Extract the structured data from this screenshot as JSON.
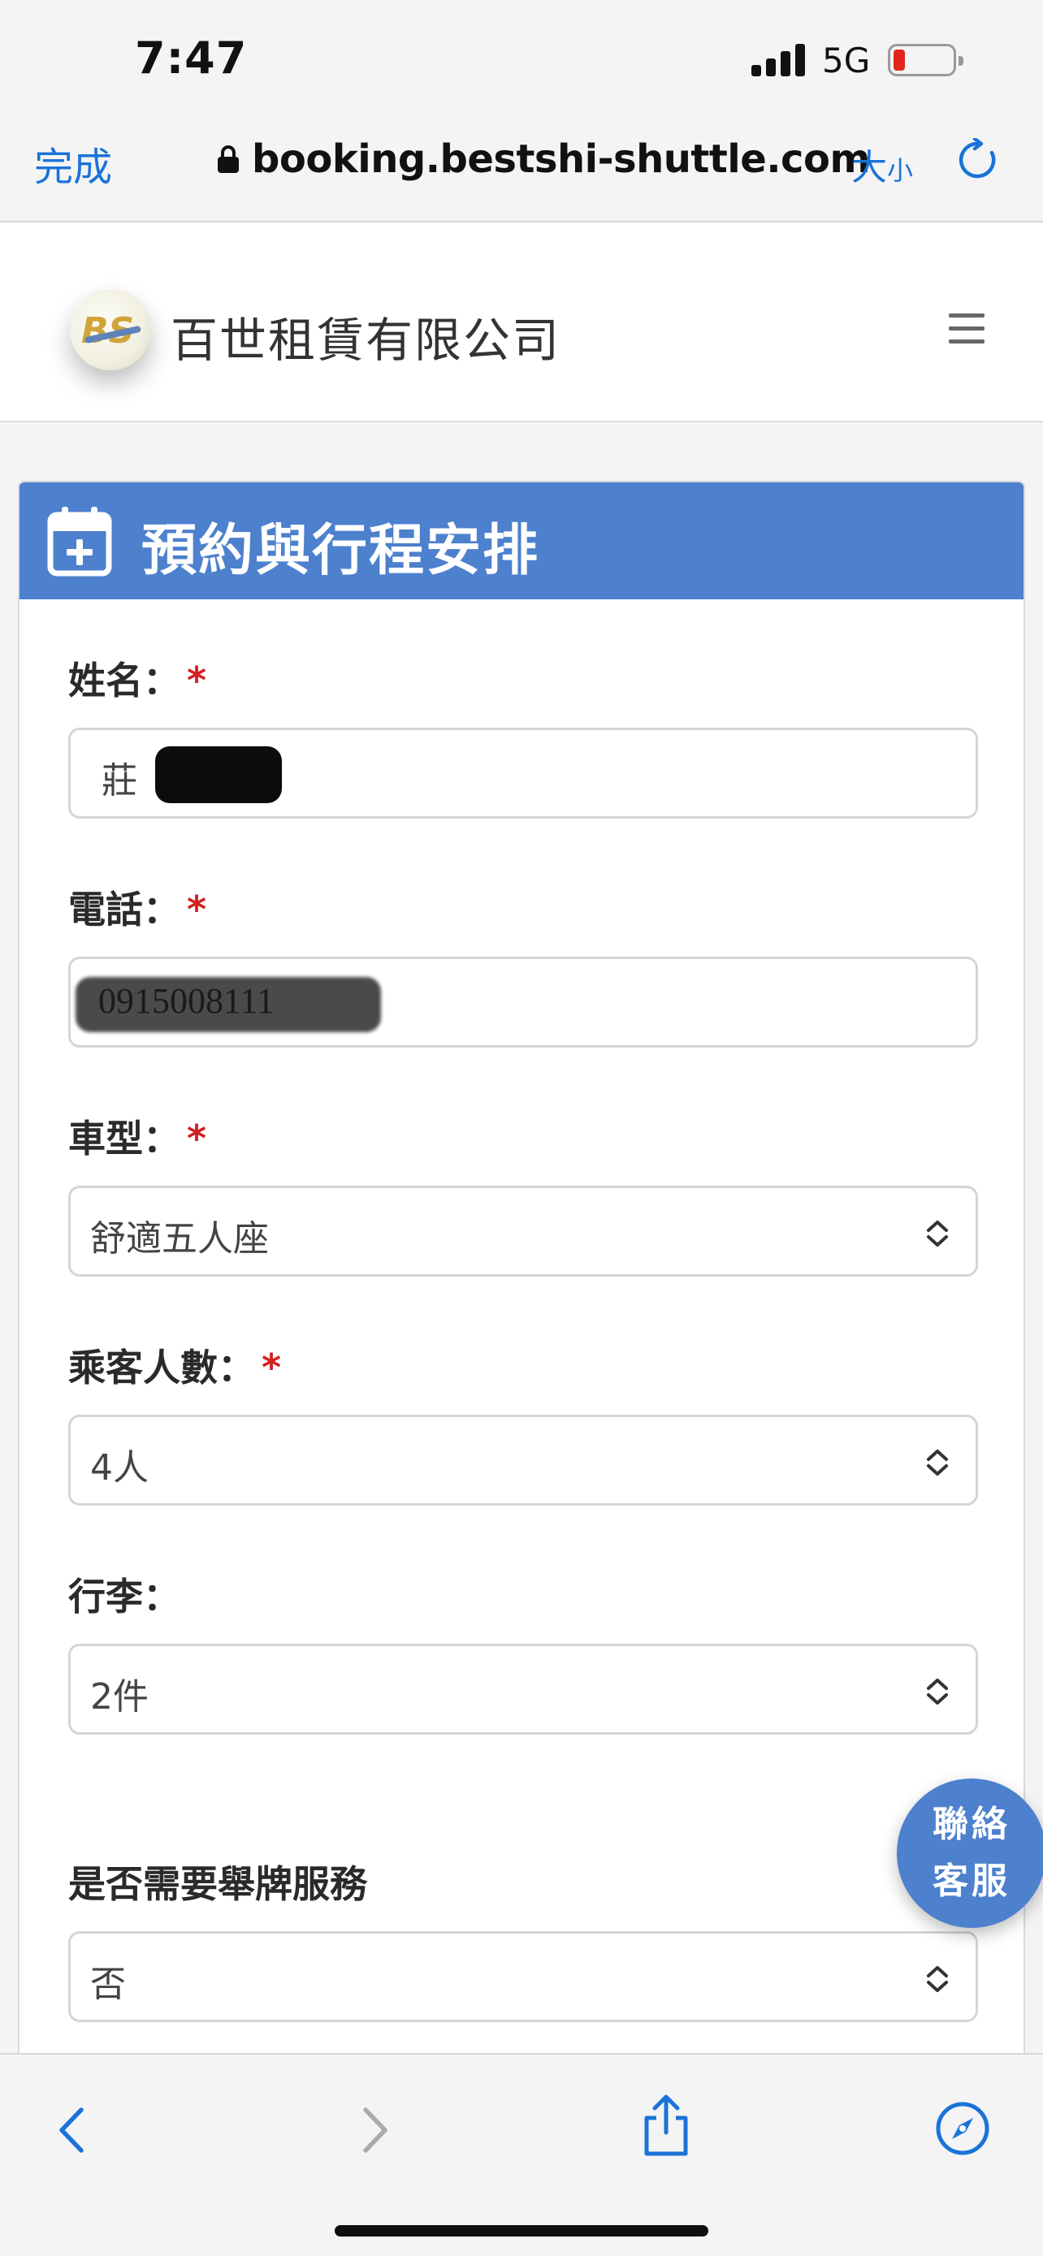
{
  "status_bar": {
    "time": "7:47",
    "network": "5G"
  },
  "browser": {
    "done_label": "完成",
    "url": "booking.bestshi-shuttle.com",
    "text_size_large": "大",
    "text_size_small": "小"
  },
  "site": {
    "company_name": "百世租賃有限公司",
    "logo_mark": "BS"
  },
  "form": {
    "title": "預約與行程安排",
    "required_mark": "*",
    "fields": [
      {
        "label": "姓名：",
        "value": "莊",
        "required": true,
        "type": "text"
      },
      {
        "label": "電話：",
        "value": "0915008111",
        "required": true,
        "type": "tel"
      },
      {
        "label": "車型：",
        "value": "舒適五人座",
        "required": true,
        "type": "select"
      },
      {
        "label": "乘客人數：",
        "value": "4人",
        "required": true,
        "type": "select"
      },
      {
        "label": "行李：",
        "value": "2件",
        "required": false,
        "type": "select"
      },
      {
        "label": "是否需要舉牌服務",
        "value": "否",
        "required": false,
        "type": "select"
      }
    ]
  },
  "contact_button": {
    "line1": "聯絡",
    "line2": "客服"
  },
  "colors": {
    "accent": "#4d80cd",
    "link": "#1a73d8",
    "required": "#d32020"
  }
}
